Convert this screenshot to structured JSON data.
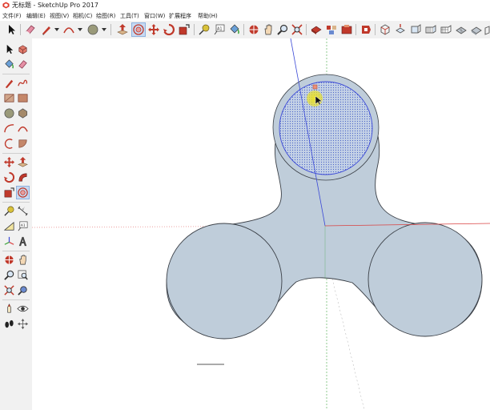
{
  "window": {
    "title": "无标题 - SketchUp Pro 2017"
  },
  "menu": [
    {
      "label": "文件(F)"
    },
    {
      "label": "编辑(E)"
    },
    {
      "label": "视图(V)"
    },
    {
      "label": "相机(C)"
    },
    {
      "label": "绘图(R)"
    },
    {
      "label": "工具(T)"
    },
    {
      "label": "窗口(W)"
    },
    {
      "label": "扩展程序"
    },
    {
      "label": "帮助(H)"
    }
  ],
  "toolbar_icons": [
    "select-icon",
    "eraser-icon",
    "pencil-icon",
    "arc-icon",
    "circle-icon",
    "push-pull-icon",
    "offset-icon",
    "move-icon",
    "rotate-icon",
    "scale-icon",
    "tape-measure-icon",
    "text-icon",
    "paint-bucket-icon",
    "orbit-icon",
    "pan-icon",
    "zoom-icon",
    "zoom-extents-icon",
    "3d-warehouse-icon",
    "components-icon",
    "extension-warehouse-icon",
    "layout-icon",
    "iso-view-icon",
    "top-view-icon",
    "front-view-icon",
    "right-view-icon",
    "back-view-icon",
    "left-view-icon",
    "xray-icon",
    "wireframe-icon"
  ],
  "left_toolbar_icons": [
    "select-icon",
    "component-icon",
    "paint-bucket-icon",
    "eraser-icon",
    "line-icon",
    "freehand-icon",
    "rectangle-icon",
    "rotated-rectangle-icon",
    "circle-icon",
    "polygon-icon",
    "arc-icon",
    "two-point-arc-icon",
    "three-point-arc-icon",
    "pie-icon",
    "move-icon",
    "push-pull-icon",
    "rotate-icon",
    "follow-me-icon",
    "scale-icon",
    "offset-icon",
    "tape-measure-icon",
    "dimension-icon",
    "protractor-icon",
    "text-icon",
    "axes-icon",
    "3d-text-icon",
    "orbit-icon",
    "pan-icon",
    "zoom-icon",
    "zoom-window-icon",
    "zoom-extents-icon",
    "previous-view-icon",
    "position-camera-icon",
    "look-around-icon",
    "walk-icon",
    "section-plane-icon"
  ],
  "colors": {
    "model_fill": "#bfcdda",
    "selected_face": "#c4d1e6",
    "selection_dot": "#4a64c8",
    "axis_red": "#d94040",
    "axis_green": "#3aa33a",
    "axis_blue": "#3a48d6",
    "cursor_highlight": "#ece21e"
  }
}
